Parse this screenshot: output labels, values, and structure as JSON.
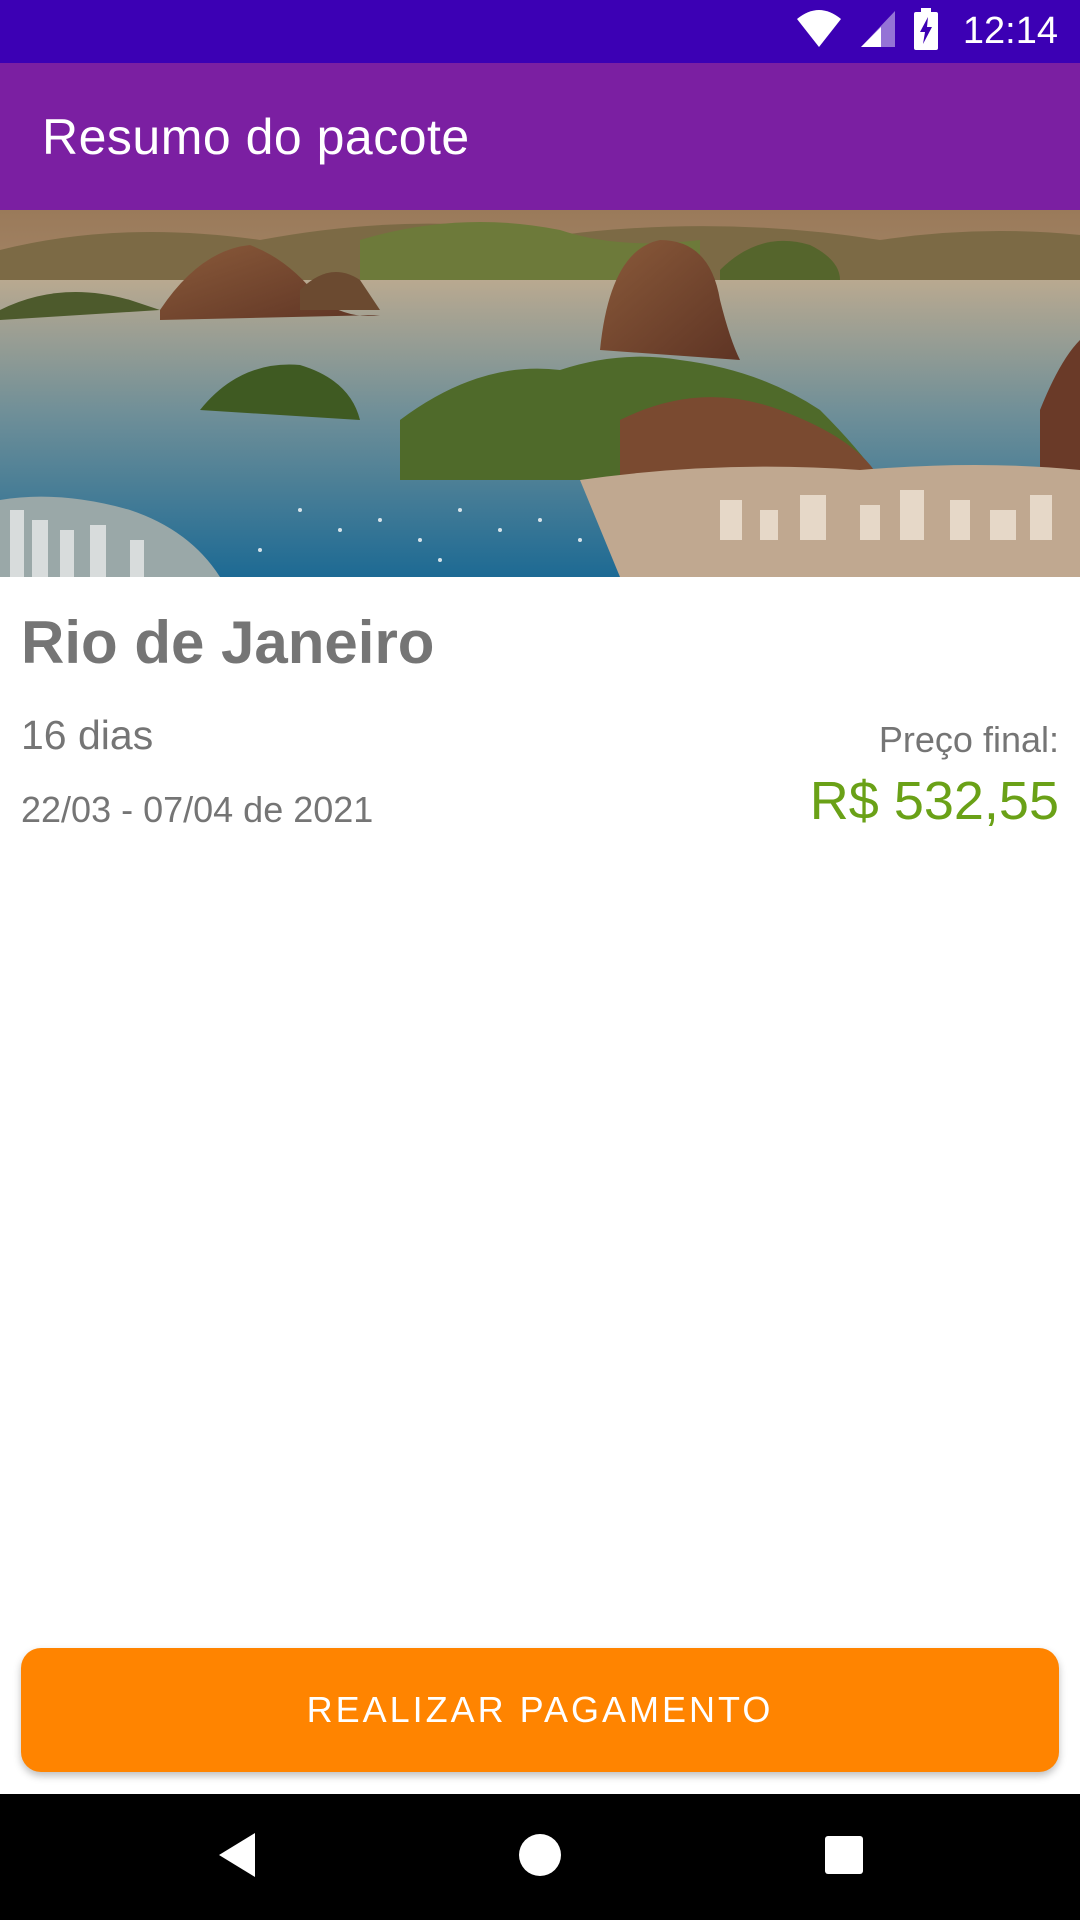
{
  "status_bar": {
    "time": "12:14",
    "icons": [
      "wifi-icon",
      "signal-icon",
      "battery-charging-icon"
    ],
    "background": "#3c00b4"
  },
  "app_bar": {
    "title": "Resumo do pacote",
    "background": "#7b1fa2"
  },
  "package": {
    "image": "rio-de-janeiro-photo",
    "destination": "Rio de Janeiro",
    "duration": "16 dias",
    "dates": "22/03 - 07/04 de 2021",
    "price_label": "Preço final:",
    "price_value": "R$ 532,55",
    "price_color": "#6aa117"
  },
  "actions": {
    "pay_label": "REALIZAR PAGAMENTO",
    "pay_color": "#ff8400"
  },
  "nav_bar": {
    "buttons": [
      "back-icon",
      "home-icon",
      "recents-icon"
    ]
  }
}
